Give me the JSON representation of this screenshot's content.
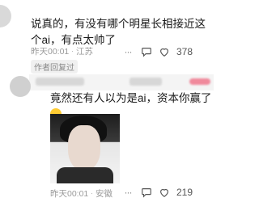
{
  "comment1": {
    "text": "说真的，有没有哪个明星长相接近这个ai，有点太帅了",
    "time": "昨天00:01",
    "location": "江苏",
    "likes": "378"
  },
  "author_badge": "作者回复过",
  "comment2": {
    "text": "竟然还有人以为是ai，资本你赢了",
    "time": "昨天00:01",
    "location": "安徽",
    "likes": "219"
  },
  "icons": {
    "more": "ellipsis-icon",
    "reply": "chat-bubble-icon",
    "like": "heart-icon",
    "emoji": "crying-laugh-emoji"
  }
}
